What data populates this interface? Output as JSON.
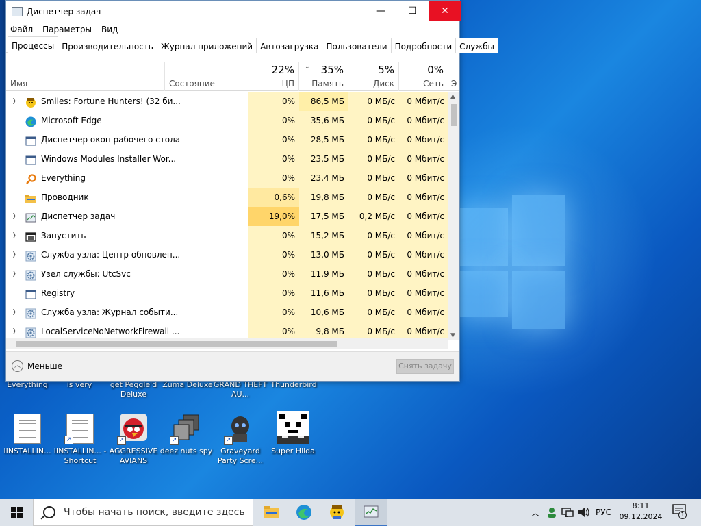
{
  "window": {
    "title": "Диспетчер задач",
    "close_glyph": "✕",
    "max_glyph": "☐",
    "min_glyph": "—"
  },
  "menu": [
    "Файл",
    "Параметры",
    "Вид"
  ],
  "tabs": [
    "Процессы",
    "Производительность",
    "Журнал приложений",
    "Автозагрузка",
    "Пользователи",
    "Подробности",
    "Службы"
  ],
  "columns": {
    "name": "Имя",
    "status": "Состояние",
    "cpu": {
      "pct": "22%",
      "label": "ЦП"
    },
    "memory": {
      "pct": "35%",
      "label": "Память"
    },
    "disk": {
      "pct": "5%",
      "label": "Диск"
    },
    "network": {
      "pct": "0%",
      "label": "Сеть"
    },
    "more": "Э"
  },
  "processes": [
    {
      "name": "Smiles: Fortune Hunters! (32 би...",
      "expandable": true,
      "icon": "smiley-icon",
      "cpu": "0%",
      "mem": "86,5 МБ",
      "disk": "0 МБ/с",
      "net": "0 Мбит/с"
    },
    {
      "name": "Microsoft Edge",
      "expandable": false,
      "icon": "edge-icon",
      "cpu": "0%",
      "mem": "35,6 МБ",
      "disk": "0 МБ/с",
      "net": "0 Мбит/с"
    },
    {
      "name": "Диспетчер окон рабочего стола",
      "expandable": false,
      "icon": "window-icon",
      "cpu": "0%",
      "mem": "28,5 МБ",
      "disk": "0 МБ/с",
      "net": "0 Мбит/с"
    },
    {
      "name": "Windows Modules Installer Wor...",
      "expandable": false,
      "icon": "window-icon",
      "cpu": "0%",
      "mem": "23,5 МБ",
      "disk": "0 МБ/с",
      "net": "0 Мбит/с"
    },
    {
      "name": "Everything",
      "expandable": false,
      "icon": "magnifier-icon",
      "cpu": "0%",
      "mem": "23,4 МБ",
      "disk": "0 МБ/с",
      "net": "0 Мбит/с"
    },
    {
      "name": "Проводник",
      "expandable": false,
      "icon": "folder-icon",
      "cpu": "0,6%",
      "mem": "19,8 МБ",
      "disk": "0 МБ/с",
      "net": "0 Мбит/с"
    },
    {
      "name": "Диспетчер задач",
      "expandable": true,
      "icon": "task-manager-icon",
      "cpu": "19,0%",
      "mem": "17,5 МБ",
      "disk": "0,2 МБ/с",
      "net": "0 Мбит/с"
    },
    {
      "name": "Запустить",
      "expandable": true,
      "icon": "run-icon",
      "cpu": "0%",
      "mem": "15,2 МБ",
      "disk": "0 МБ/с",
      "net": "0 Мбит/с"
    },
    {
      "name": "Служба узла: Центр обновлен...",
      "expandable": true,
      "icon": "gear-icon",
      "cpu": "0%",
      "mem": "13,0 МБ",
      "disk": "0 МБ/с",
      "net": "0 Мбит/с"
    },
    {
      "name": "Узел службы: UtcSvc",
      "expandable": true,
      "icon": "gear-icon",
      "cpu": "0%",
      "mem": "11,9 МБ",
      "disk": "0 МБ/с",
      "net": "0 Мбит/с"
    },
    {
      "name": "Registry",
      "expandable": false,
      "icon": "window-icon",
      "cpu": "0%",
      "mem": "11,6 МБ",
      "disk": "0 МБ/с",
      "net": "0 Мбит/с"
    },
    {
      "name": "Служба узла: Журнал событи...",
      "expandable": true,
      "icon": "gear-icon",
      "cpu": "0%",
      "mem": "10,6 МБ",
      "disk": "0 МБ/с",
      "net": "0 Мбит/с"
    },
    {
      "name": "LocalServiceNoNetworkFirewall ...",
      "expandable": true,
      "icon": "gear-icon",
      "cpu": "0%",
      "mem": "9,8 МБ",
      "disk": "0 МБ/с",
      "net": "0 Мбит/с"
    }
  ],
  "footer": {
    "less": "Меньше",
    "end_task": "Снять задачу"
  },
  "desktop": {
    "partial_labels": [
      "Everything",
      "is very",
      "get Peggle'd Deluxe",
      "Zuma Deluxe",
      "GRAND THEFT AU...",
      "Thunderbird"
    ],
    "icons": [
      {
        "label": "IINSTALLIN...",
        "icon": "text-document-icon"
      },
      {
        "label": "IINSTALLIN... - Shortcut",
        "icon": "text-document-icon"
      },
      {
        "label": "AGGRESSIVE AVIANS",
        "icon": "angry-bird-icon"
      },
      {
        "label": "deez nuts spy",
        "icon": "window-stack-icon"
      },
      {
        "label": "Graveyard Party Scre...",
        "icon": "skull-icon"
      },
      {
        "label": "Super Hilda",
        "icon": "pixel-art-icon"
      }
    ]
  },
  "taskbar": {
    "search_placeholder": "Чтобы начать поиск, введите здесь",
    "lang": "РУС",
    "time": "8:11",
    "date": "09.12.2024",
    "notifications": "1"
  },
  "colors": {
    "heat_light": "#fff4c4",
    "heat_hot": "#ffd56a",
    "close": "#e81123",
    "accent": "#3a74c6"
  }
}
